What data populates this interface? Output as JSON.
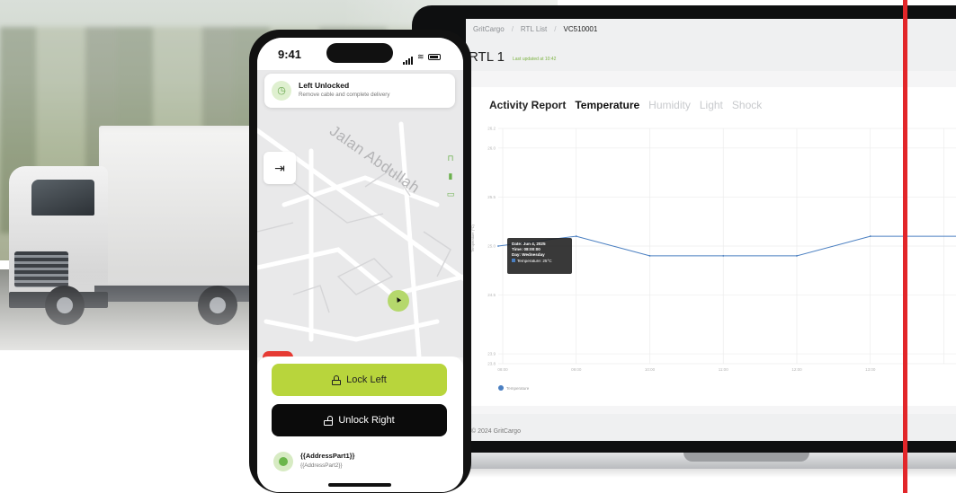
{
  "phone": {
    "time": "9:41",
    "notification": {
      "title": "Left Unlocked",
      "subtitle": "Remove cable and complete delivery"
    },
    "map": {
      "street_name": "Jalan Abdullah"
    },
    "buttons": {
      "lock_left": "Lock Left",
      "unlock_right": "Unlock Right"
    },
    "address": {
      "line1": "{{AddressPart1}}",
      "line2": "{{AddressPart2}}"
    },
    "accent": "#b8d53c",
    "alarm_color": "#e63a33"
  },
  "dashboard": {
    "breadcrumbs": [
      "GritCargo",
      "RTL List",
      "VC510001"
    ],
    "page_title": "RTL 1",
    "last_updated": "Last updated at 10:42",
    "tabs": {
      "heading": "Activity Report",
      "active": "Temperature",
      "others": [
        "Humidity",
        "Light",
        "Shock"
      ]
    },
    "footer": "© 2024 GritCargo",
    "tooltip": {
      "date": "Date: Jun 4, 2025",
      "time": "Time: 08:00:00",
      "day": "Day: Wednesday",
      "temperature": "Temperature: 25°C"
    }
  },
  "chart_data": {
    "type": "line",
    "ylabel": "Temperature (°C)",
    "ylim": [
      23.8,
      26.2
    ],
    "yticks": [
      23.8,
      23.9,
      24.5,
      25.0,
      25.5,
      26.0,
      26.2
    ],
    "ytick_labels": [
      "23.8",
      "23.9",
      "24.5",
      "25.0",
      "25.5",
      "26.0",
      "26.2"
    ],
    "categories": [
      "08:00",
      "09:00",
      "10:00",
      "11:00",
      "12:00",
      "13:00"
    ],
    "series": [
      {
        "name": "Temperature",
        "color": "#4a7fc1",
        "values": [
          25.0,
          25.1,
          24.9,
          24.9,
          24.9,
          25.1,
          25.1
        ]
      }
    ],
    "x_positions": [
      "08:00",
      "09:00",
      "10:00",
      "11:00",
      "12:00",
      "13:00",
      "14:00"
    ],
    "legend": "bottom-left",
    "grid": true
  }
}
